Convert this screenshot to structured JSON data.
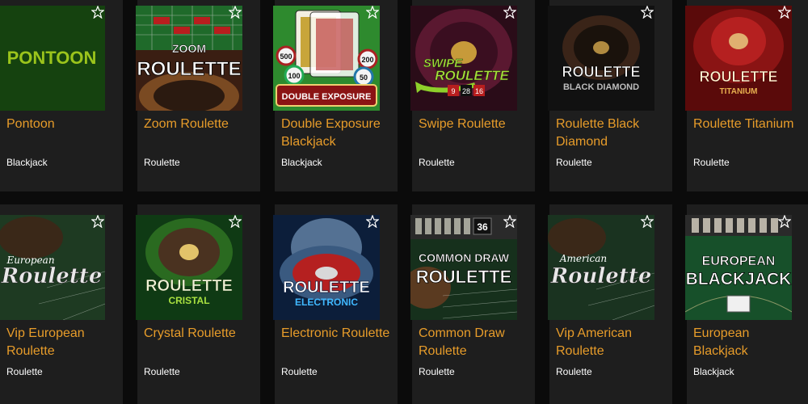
{
  "accent_color": "#e79c2a",
  "games": [
    {
      "title": "Pontoon",
      "category": "Blackjack",
      "art_text": [
        "PONTOON"
      ],
      "favorite_icon": "star-outline-icon"
    },
    {
      "title": "Zoom Roulette",
      "category": "Roulette",
      "art_text": [
        "ZOOM",
        "ROULETTE"
      ],
      "favorite_icon": "star-outline-icon"
    },
    {
      "title": "Double Exposure Blackjack",
      "category": "Blackjack",
      "art_text": [
        "DOUBLE EXPOSURE",
        "500",
        "100",
        "200",
        "50"
      ],
      "favorite_icon": "star-outline-icon"
    },
    {
      "title": "Swipe Roulette",
      "category": "Roulette",
      "art_text": [
        "SWIPE",
        "ROULETTE",
        "9",
        "28",
        "16"
      ],
      "favorite_icon": "star-outline-icon"
    },
    {
      "title": "Roulette Black Diamond",
      "category": "Roulette",
      "art_text": [
        "ROULETTE",
        "BLACK DIAMOND"
      ],
      "favorite_icon": "star-outline-icon"
    },
    {
      "title": "Roulette Titanium",
      "category": "Roulette",
      "art_text": [
        "ROULETTE",
        "TITANIUM"
      ],
      "favorite_icon": "star-outline-icon"
    },
    {
      "title": "Vip European Roulette",
      "category": "Roulette",
      "art_text": [
        "European",
        "Roulette"
      ],
      "favorite_icon": "star-outline-icon"
    },
    {
      "title": "Crystal Roulette",
      "category": "Roulette",
      "art_text": [
        "ROULETTE",
        "CRISTAL"
      ],
      "favorite_icon": "star-outline-icon"
    },
    {
      "title": "Electronic Roulette",
      "category": "Roulette",
      "art_text": [
        "ROULETTE",
        "ELECTRONIC"
      ],
      "favorite_icon": "star-outline-icon"
    },
    {
      "title": "Common Draw Roulette",
      "category": "Roulette",
      "art_text": [
        "COMMON DRAW",
        "ROULETTE",
        "36"
      ],
      "favorite_icon": "star-outline-icon"
    },
    {
      "title": "Vip American Roulette",
      "category": "Roulette",
      "art_text": [
        "American",
        "Roulette"
      ],
      "favorite_icon": "star-outline-icon"
    },
    {
      "title": "European Blackjack",
      "category": "Blackjack",
      "art_text": [
        "EUROPEAN",
        "BLACKJACK"
      ],
      "favorite_icon": "star-outline-icon"
    }
  ]
}
